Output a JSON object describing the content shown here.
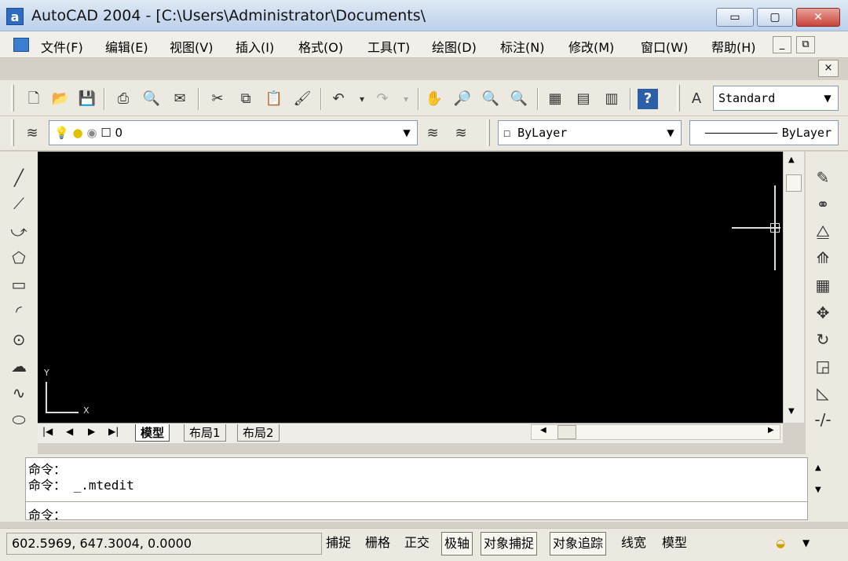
{
  "window": {
    "app_icon": "a",
    "title": "AutoCAD 2004 - [C:\\Users\\Administrator\\Documents\\",
    "minimize": "▭",
    "maximize": "▢",
    "close": "✕"
  },
  "menu": {
    "items": [
      "文件(F)",
      "编辑(E)",
      "视图(V)",
      "插入(I)",
      "格式(O)",
      "工具(T)",
      "绘图(D)",
      "标注(N)",
      "修改(M)",
      "窗口(W)",
      "帮助(H)"
    ],
    "mdi_minimize": "_",
    "mdi_restore": "⧉",
    "mdi_close": "×"
  },
  "toolbar_standard": {
    "text_style_value": "Standard"
  },
  "toolbar_layers": {
    "layer_value": "0",
    "color_value": "ByLayer",
    "linetype_value": "ByLayer"
  },
  "ucs": {
    "y_label": "Y",
    "x_label": "X"
  },
  "tabs": {
    "nav": [
      "|◀",
      "◀",
      "▶",
      "▶|"
    ],
    "items": [
      "模型",
      "布局1",
      "布局2"
    ]
  },
  "command": {
    "lines": [
      "命令：",
      "命令： _.mtedit",
      "命令："
    ]
  },
  "status": {
    "coords": "602.5969, 647.3004, 0.0000",
    "buttons": [
      {
        "label": "捕捉",
        "on": false
      },
      {
        "label": "栅格",
        "on": false
      },
      {
        "label": "正交",
        "on": false
      },
      {
        "label": "极轴",
        "on": true
      },
      {
        "label": "对象捕捉",
        "on": true
      },
      {
        "label": "对象追踪",
        "on": true
      },
      {
        "label": "线宽",
        "on": false
      },
      {
        "label": "模型",
        "on": false
      }
    ]
  },
  "colors": {
    "canvas": "#000000",
    "titlebar": "#c9d9ee",
    "close_button": "#c8453a"
  }
}
